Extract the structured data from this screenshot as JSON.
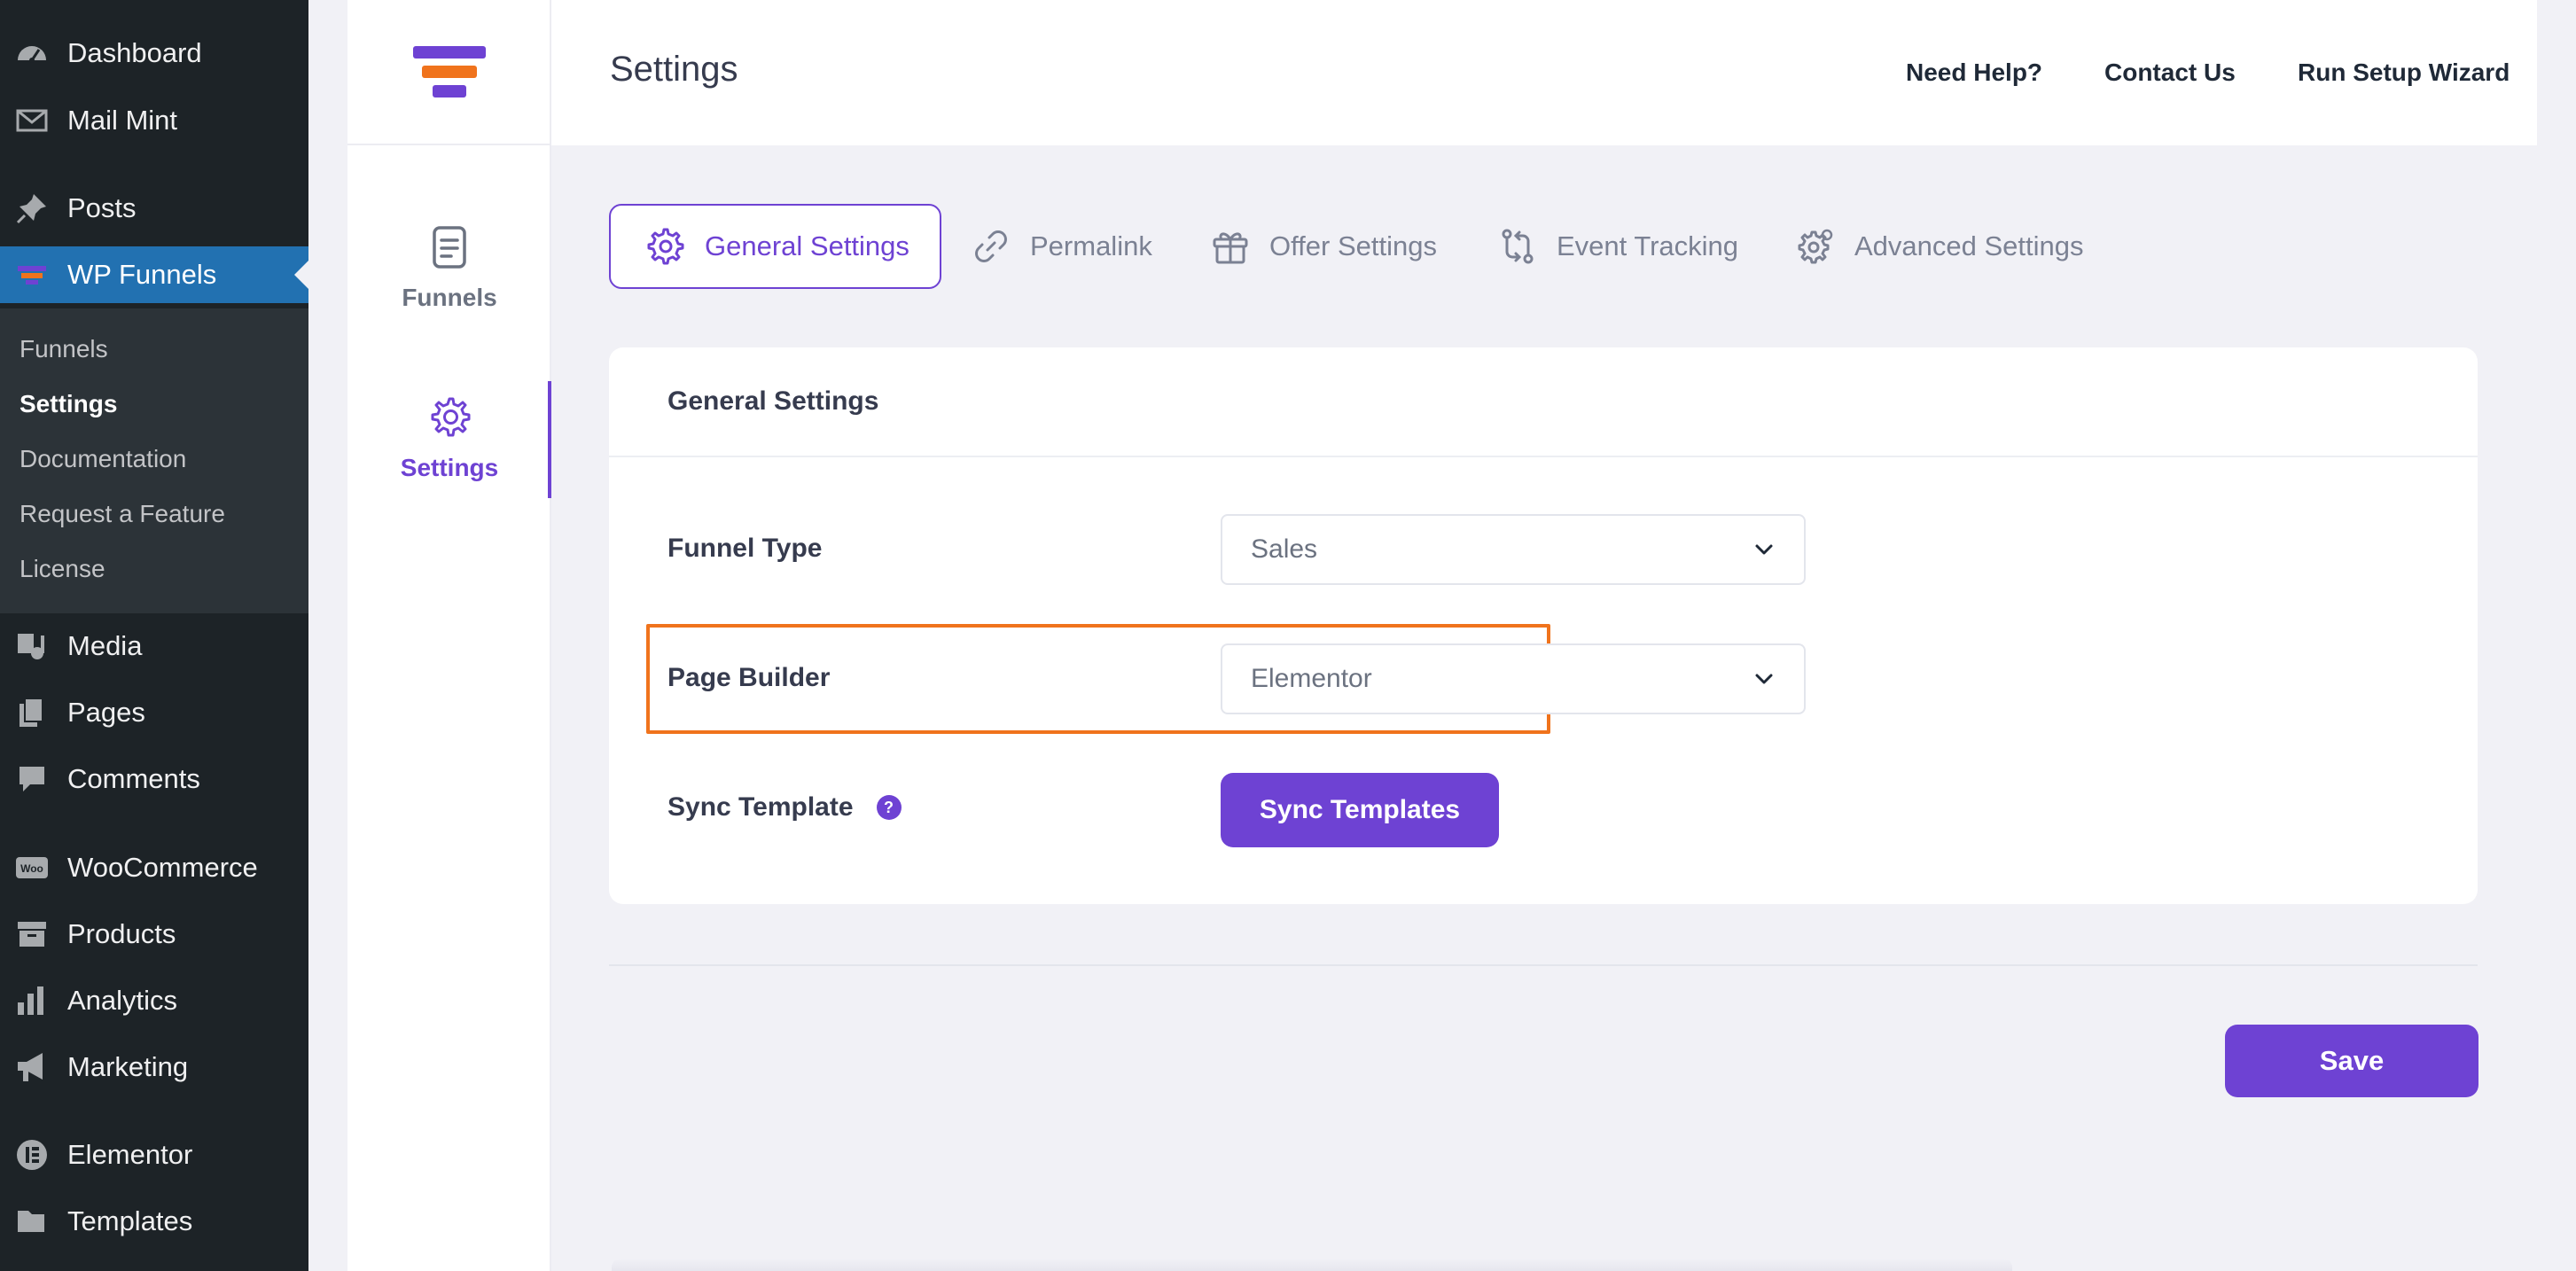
{
  "wp_menu": {
    "items": [
      {
        "label": "Dashboard",
        "icon": "dashboard-icon"
      },
      {
        "label": "Mail Mint",
        "icon": "mail-icon"
      },
      {
        "label": "Posts",
        "icon": "pin-icon"
      },
      {
        "label": "WP Funnels",
        "icon": "funnel-icon",
        "active": true
      },
      {
        "label": "Media",
        "icon": "media-icon"
      },
      {
        "label": "Pages",
        "icon": "pages-icon"
      },
      {
        "label": "Comments",
        "icon": "comment-icon"
      },
      {
        "label": "WooCommerce",
        "icon": "woocommerce-icon"
      },
      {
        "label": "Products",
        "icon": "archive-icon"
      },
      {
        "label": "Analytics",
        "icon": "bar-chart-icon"
      },
      {
        "label": "Marketing",
        "icon": "megaphone-icon"
      },
      {
        "label": "Elementor",
        "icon": "elementor-icon"
      },
      {
        "label": "Templates",
        "icon": "folder-icon"
      }
    ],
    "submenu": [
      {
        "label": "Funnels"
      },
      {
        "label": "Settings",
        "current": true
      },
      {
        "label": "Documentation"
      },
      {
        "label": "Request a Feature"
      },
      {
        "label": "License"
      }
    ]
  },
  "rail": {
    "items": [
      {
        "label": "Funnels",
        "icon": "document-icon"
      },
      {
        "label": "Settings",
        "icon": "gear-icon",
        "active": true
      }
    ]
  },
  "header": {
    "title": "Settings",
    "links": [
      "Need Help?",
      "Contact Us",
      "Run Setup Wizard"
    ]
  },
  "tabs": [
    {
      "label": "General Settings",
      "icon": "gear-icon",
      "active": true
    },
    {
      "label": "Permalink",
      "icon": "link-icon"
    },
    {
      "label": "Offer Settings",
      "icon": "gift-icon"
    },
    {
      "label": "Event Tracking",
      "icon": "tracking-icon"
    },
    {
      "label": "Advanced Settings",
      "icon": "gears-icon"
    }
  ],
  "card": {
    "title": "General Settings",
    "funnel_type": {
      "label": "Funnel Type",
      "value": "Sales"
    },
    "page_builder": {
      "label": "Page Builder",
      "value": "Elementor"
    },
    "sync": {
      "label": "Sync Template",
      "help": "?",
      "button": "Sync Templates"
    }
  },
  "save_label": "Save",
  "colors": {
    "accent": "#6e42d3",
    "wp_sidebar": "#1d2327",
    "wp_active": "#2271b1",
    "highlight": "#f0731c"
  }
}
